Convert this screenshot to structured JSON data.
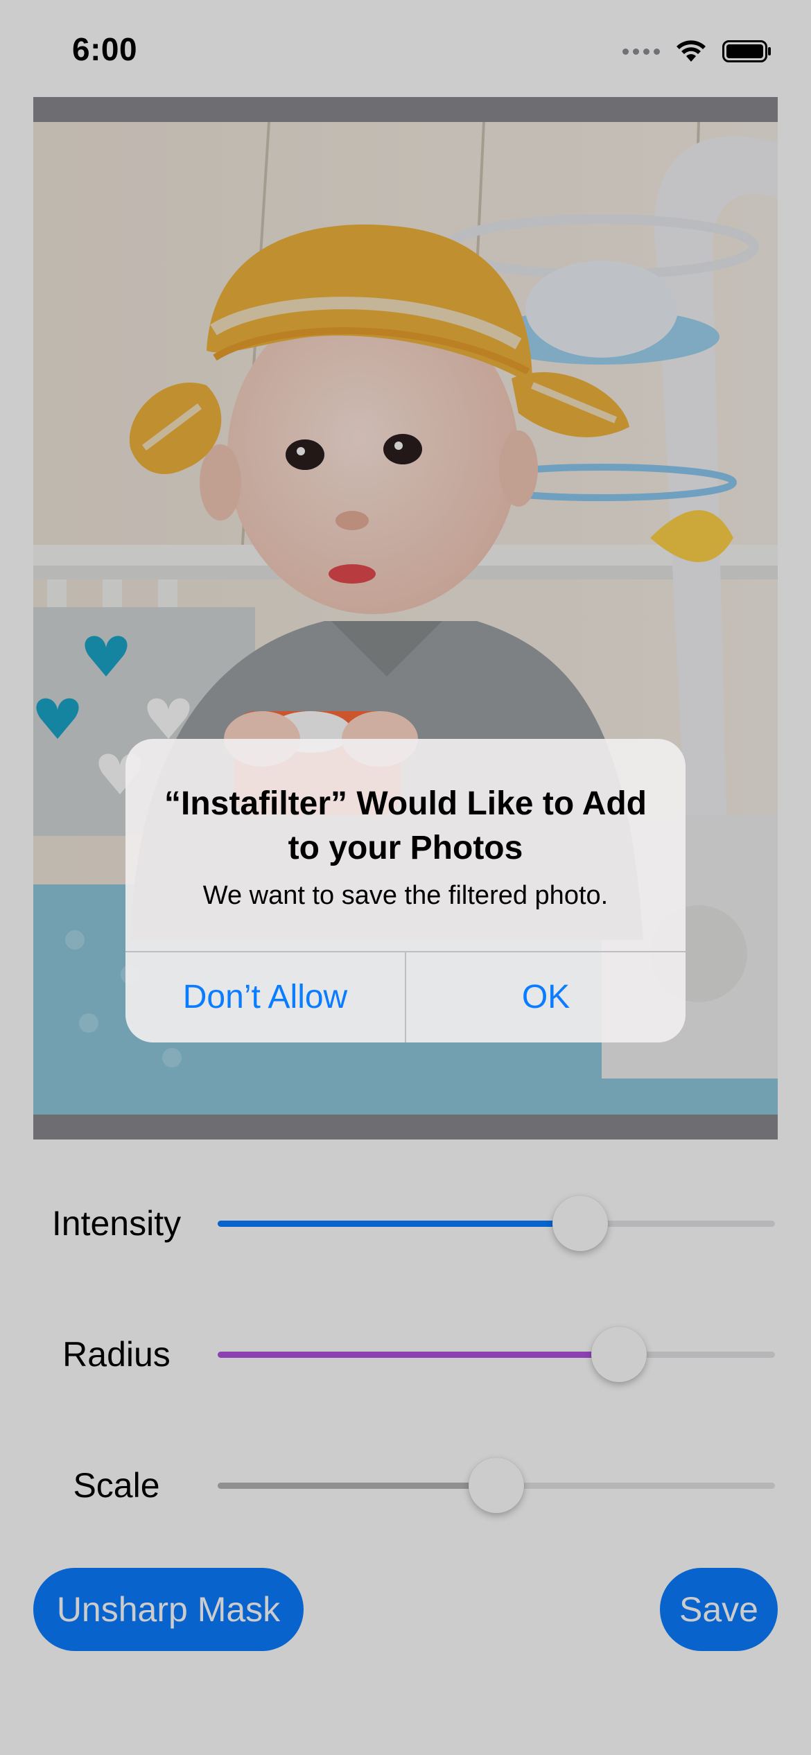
{
  "status_bar": {
    "time": "6:00"
  },
  "photo": {
    "description_icon": "baby-photo"
  },
  "controls": [
    {
      "label": "Intensity",
      "value": 0.65,
      "color": "#0a7cff"
    },
    {
      "label": "Radius",
      "value": 0.72,
      "color": "#af52de"
    },
    {
      "label": "Scale",
      "value": 0.5,
      "color": "#b4b4b8"
    }
  ],
  "buttons": {
    "filter_label": "Unsharp Mask",
    "save_label": "Save"
  },
  "alert": {
    "title": "“Instafilter” Would Like to Add to your Photos",
    "message": "We want to save the filtered photo.",
    "deny_label": "Don’t Allow",
    "ok_label": "OK"
  },
  "colors": {
    "accent": "#0a7cff",
    "radius_slider": "#af52de"
  }
}
